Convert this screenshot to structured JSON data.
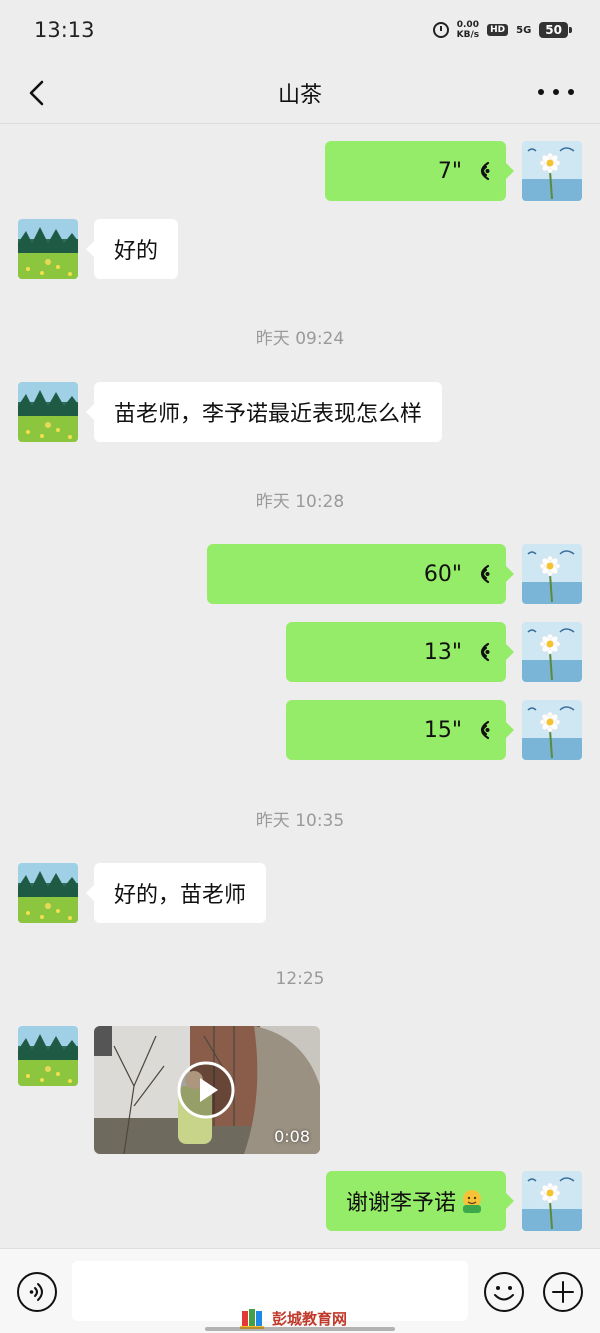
{
  "status_bar": {
    "time": "13:13",
    "net_speed": "0.00",
    "net_unit": "KB/s",
    "hd": "HD",
    "signal": "5G",
    "battery": "50"
  },
  "header": {
    "title": "山茶",
    "back_icon": "chevron-left-icon",
    "more_icon": "more-dots-icon"
  },
  "messages": [
    {
      "type": "voice",
      "side": "out",
      "duration": "7\""
    },
    {
      "type": "text",
      "side": "in",
      "text": "好的"
    },
    {
      "type": "time",
      "text": "昨天 09:24"
    },
    {
      "type": "text",
      "side": "in",
      "text": "苗老师，李予诺最近表现怎么样"
    },
    {
      "type": "time",
      "text": "昨天 10:28"
    },
    {
      "type": "voice",
      "side": "out",
      "duration": "60\""
    },
    {
      "type": "voice",
      "side": "out",
      "duration": "13\""
    },
    {
      "type": "voice",
      "side": "out",
      "duration": "15\""
    },
    {
      "type": "time",
      "text": "昨天 10:35"
    },
    {
      "type": "text",
      "side": "in",
      "text": "好的，苗老师"
    },
    {
      "type": "time",
      "text": "12:25"
    },
    {
      "type": "video",
      "side": "in",
      "duration": "0:08"
    },
    {
      "type": "text",
      "side": "out",
      "text": "谢谢李予诺",
      "emoji": "thumbs-up-emoji"
    }
  ],
  "input_bar": {
    "placeholder": "",
    "voice_icon": "voice-input-icon",
    "emoji_icon": "smiley-icon",
    "plus_icon": "plus-icon"
  },
  "watermark": {
    "text": "彭城教育网"
  },
  "colors": {
    "background": "#ededed",
    "outgoing_bubble": "#95ec69",
    "incoming_bubble": "#ffffff",
    "timestamp": "#9a9a9a"
  }
}
